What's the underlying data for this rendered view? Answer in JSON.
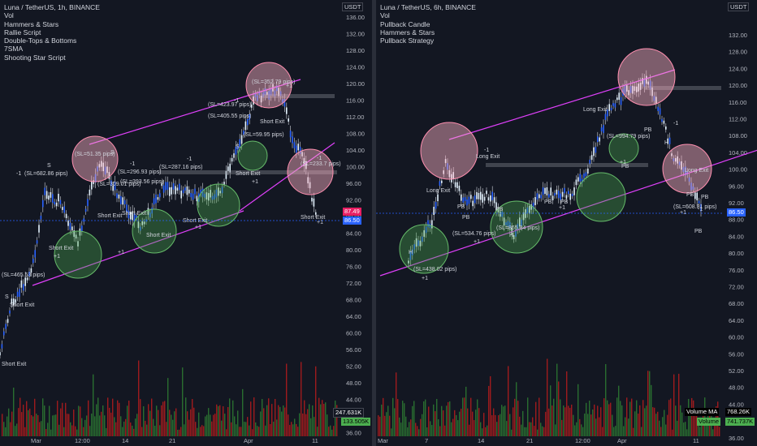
{
  "left": {
    "legend": [
      "Luna / TetherUS, 1h, BINANCE",
      "Vol",
      "Hammers & Stars",
      "Rallie Script",
      "Double-Tops & Bottoms",
      "7SMA",
      "Shooting Star Script"
    ],
    "axis_badge": "USDT",
    "y_ticks": [
      "136.00",
      "132.00",
      "128.00",
      "124.00",
      "120.00",
      "116.00",
      "112.00",
      "108.00",
      "104.00",
      "100.00",
      "96.00",
      "92.00",
      "88.00",
      "84.00",
      "80.00",
      "76.00",
      "72.00",
      "68.00",
      "64.00",
      "60.00",
      "56.00",
      "52.00",
      "48.00",
      "44.00",
      "40.00",
      "36.00"
    ],
    "x_ticks": [
      "Mar",
      "12:00",
      "14",
      "21",
      "Apr",
      "11"
    ],
    "price_tags": [
      "87.49",
      "86.50"
    ],
    "vol_tags": [
      "247.631K",
      "133.505K"
    ],
    "signals": [
      "(SL=51.35 pips)",
      "(SL=682.86 pips)",
      "(SL=296.93 pips)",
      "(SL=393.56 pips)",
      "(SL=309.01 pips)",
      "(SL=287.16 pips)",
      "(SL=423.97 pips)",
      "(SL=405.55 pips)",
      "(SL=352.79 pips)",
      "(SL=59.95 pips)",
      "(SL=233.7 pips)",
      "(SL=465.53 pips)",
      "Short Exit",
      "Short Exit",
      "Short Exit",
      "Short Exit",
      "Short Exit",
      "Short Exit",
      "Short Exit",
      "Short Exit",
      "Short Exit",
      "Short Exit",
      "-1",
      "-1",
      "-1",
      "-1",
      "-1",
      "+1",
      "+1",
      "+1",
      "+1",
      "+1",
      "+1",
      "S",
      "S",
      "S",
      "S"
    ]
  },
  "right": {
    "legend": [
      "Luna / TetherUS, 6h, BINANCE",
      "Vol",
      "Pullback Candle",
      "Hammers & Stars",
      "Pullback Strategy"
    ],
    "axis_badge": "USDT",
    "y_ticks": [
      "132.00",
      "128.00",
      "124.00",
      "120.00",
      "116.00",
      "112.00",
      "108.00",
      "104.00",
      "100.00",
      "96.00",
      "92.00",
      "88.00",
      "84.00",
      "80.00",
      "76.00",
      "72.00",
      "68.00",
      "64.00",
      "60.00",
      "56.00",
      "52.00",
      "48.00",
      "44.00",
      "40.00",
      "36.00"
    ],
    "x_ticks": [
      "Mar",
      "7",
      "14",
      "21",
      "12:00",
      "Apr",
      "11"
    ],
    "price_tag": "86.50",
    "vol_ma_label": "Volume MA",
    "vol_ma_value": "768.26K",
    "vol_label": "Volume",
    "vol_value": "741.737K",
    "signals": [
      "Long Exit",
      "Long Exit",
      "Long Exit",
      "Long Exit",
      "(SL=534.76 pips)",
      "(SL=865.84 pips)",
      "(SL=994.79 pips)",
      "(SL=438.02 pips)",
      "(SL=608.81 pips)",
      "PB",
      "PB",
      "PB",
      "PB",
      "PB",
      "PB",
      "PB",
      "PB",
      "PB",
      "PB",
      "H",
      "H",
      "H",
      "-1",
      "-1",
      "-1",
      "+1",
      "+1",
      "+1",
      "+1",
      "+1"
    ]
  },
  "colors": {
    "background": "#131722",
    "bull": "#26a69a",
    "bear": "#ef5350",
    "candle_blue": "#2962ff",
    "channel": "#e040fb",
    "circle_red": "#ffb4c8",
    "circle_green": "#66bb6a",
    "price_tag": "#2962ff",
    "vol_tag": "#4caf50"
  }
}
